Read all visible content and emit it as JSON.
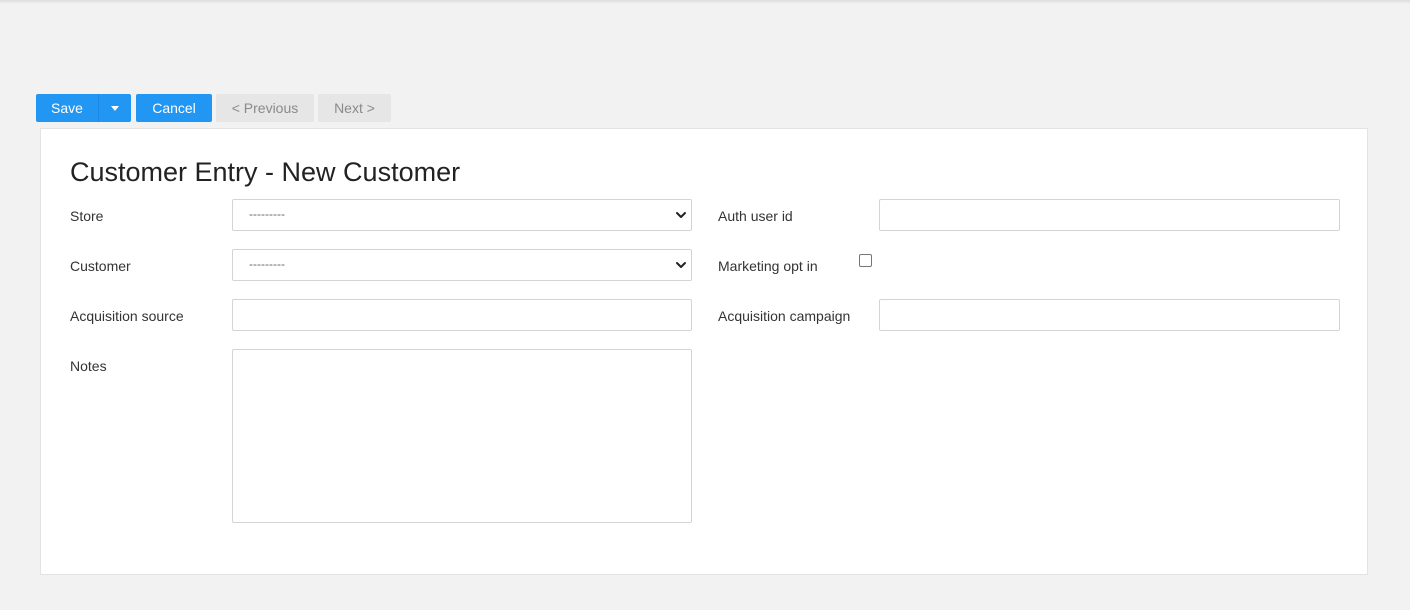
{
  "toolbar": {
    "save_label": "Save",
    "cancel_label": "Cancel",
    "previous_label": "< Previous",
    "next_label": "Next >"
  },
  "form": {
    "title": "Customer Entry - New Customer",
    "store": {
      "label": "Store",
      "value": "---------"
    },
    "customer": {
      "label": "Customer",
      "value": "---------"
    },
    "acquisition_source": {
      "label": "Acquisition source",
      "value": ""
    },
    "notes": {
      "label": "Notes",
      "value": ""
    },
    "auth_user_id": {
      "label": "Auth user id",
      "value": ""
    },
    "marketing_opt_in": {
      "label": "Marketing opt in",
      "checked": false
    },
    "acquisition_campaign": {
      "label": "Acquisition campaign",
      "value": ""
    }
  },
  "colors": {
    "primary": "#2196f3",
    "disabled_bg": "#e6e6e6",
    "page_bg": "#f2f2f2"
  },
  "icons": {
    "save_menu": "caret-down-icon",
    "select_arrow": "chevron-down-icon"
  }
}
